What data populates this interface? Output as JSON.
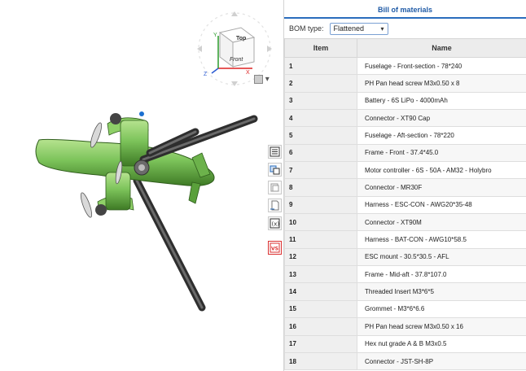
{
  "bom": {
    "title": "Bill of materials",
    "type_label": "BOM type:",
    "type_value": "Flattened",
    "columns": {
      "item": "Item",
      "name": "Name"
    },
    "rows": [
      {
        "item": "1",
        "name": "Fuselage - Front-section - 78*240"
      },
      {
        "item": "2",
        "name": "PH Pan head screw M3x0.50 x 8"
      },
      {
        "item": "3",
        "name": "Battery - 6S LiPo - 4000mAh"
      },
      {
        "item": "4",
        "name": "Connector - XT90 Cap"
      },
      {
        "item": "5",
        "name": "Fuselage - Aft-section - 78*220"
      },
      {
        "item": "6",
        "name": "Frame - Front - 37.4*45.0"
      },
      {
        "item": "7",
        "name": "Motor controller - 6S - 50A - AM32 - Holybro"
      },
      {
        "item": "8",
        "name": "Connector - MR30F"
      },
      {
        "item": "9",
        "name": "Harness - ESC-CON - AWG20*35-48"
      },
      {
        "item": "10",
        "name": "Connector - XT90M"
      },
      {
        "item": "11",
        "name": "Harness - BAT-CON - AWG10*58.5"
      },
      {
        "item": "12",
        "name": "ESC mount - 30.5*30.5 - AFL"
      },
      {
        "item": "13",
        "name": "Frame - Mid-aft - 37.8*107.0"
      },
      {
        "item": "14",
        "name": "Threaded Insert M3*6*5"
      },
      {
        "item": "15",
        "name": "Grommet - M3*6*6.6"
      },
      {
        "item": "16",
        "name": "PH Pan head screw M3x0.50 x 16"
      },
      {
        "item": "17",
        "name": "Hex nut grade A & B M3x0.5"
      },
      {
        "item": "18",
        "name": "Connector - JST-SH-8P"
      }
    ]
  },
  "view_cube": {
    "top": "Top",
    "front": "Front",
    "axis_x": "X",
    "axis_y": "Y",
    "axis_z": "Z"
  },
  "colors": {
    "model_green": "#7cc35a",
    "accent_blue": "#2a6dbd"
  }
}
